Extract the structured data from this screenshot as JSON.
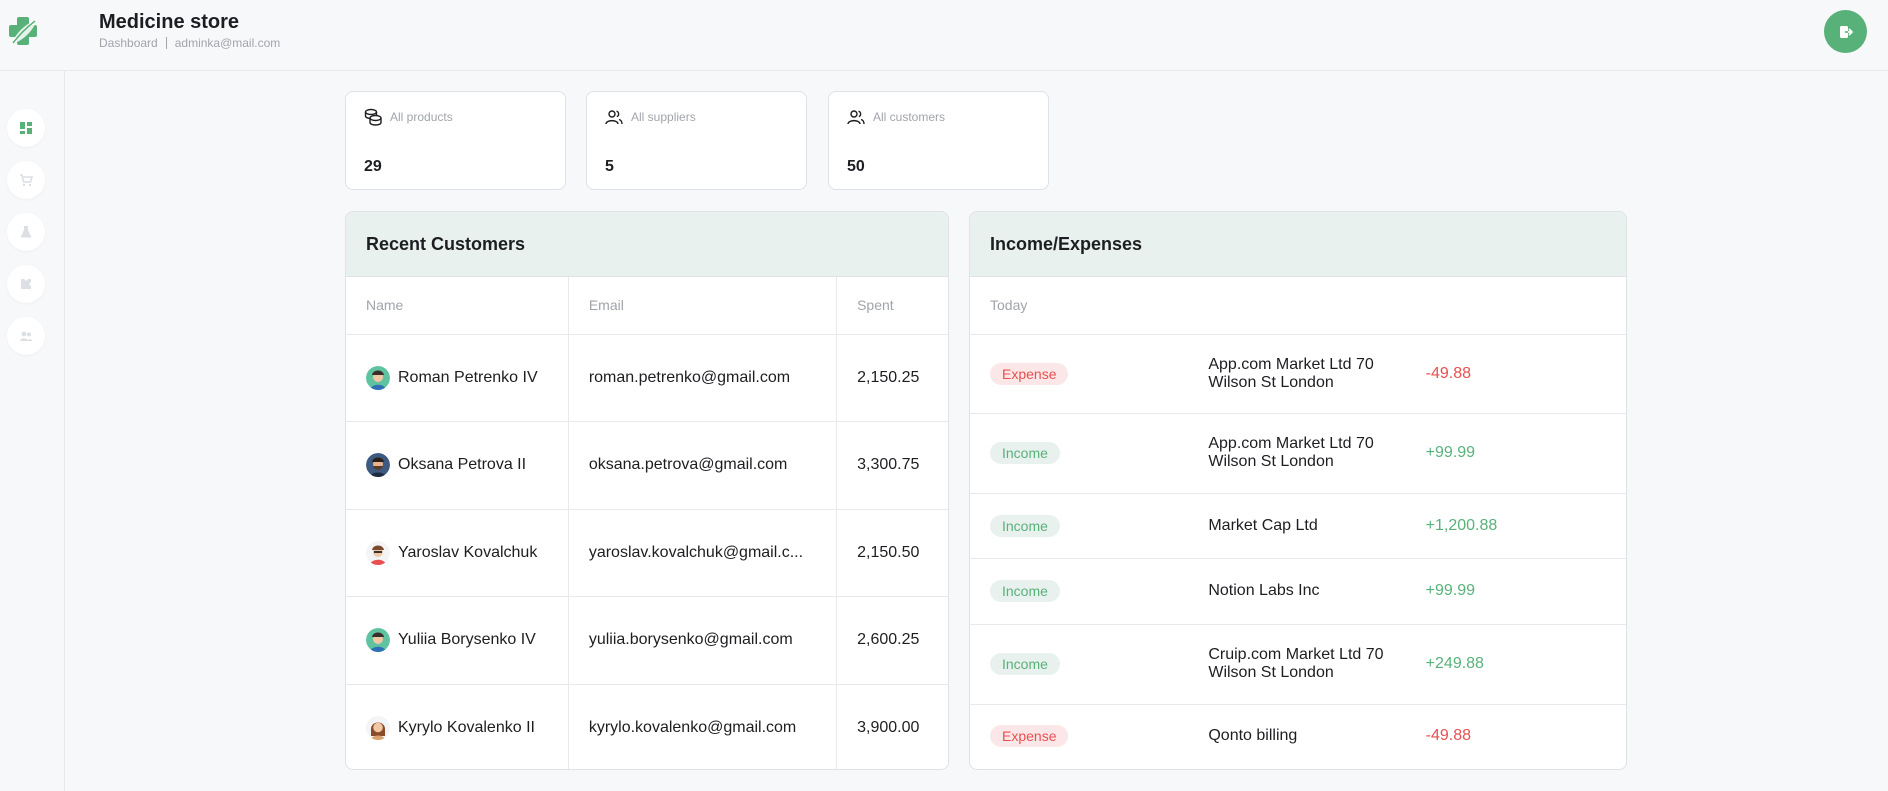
{
  "header": {
    "title": "Medicine store",
    "breadcrumb": "Dashboard",
    "email": "adminka@mail.com",
    "logout_icon": "logout-icon"
  },
  "sidebar": {
    "items": [
      {
        "icon": "dashboard-icon",
        "active": true
      },
      {
        "icon": "cart-icon",
        "active": false
      },
      {
        "icon": "flask-icon",
        "active": false
      },
      {
        "icon": "puzzle-icon",
        "active": false
      },
      {
        "icon": "users-icon",
        "active": false
      }
    ]
  },
  "stats": [
    {
      "label": "All products",
      "value": "29",
      "icon": "coins-icon"
    },
    {
      "label": "All suppliers",
      "value": "5",
      "icon": "users-icon"
    },
    {
      "label": "All customers",
      "value": "50",
      "icon": "users-icon"
    }
  ],
  "recent_customers": {
    "title": "Recent Customers",
    "columns": [
      "Name",
      "Email",
      "Spent"
    ],
    "rows": [
      {
        "name": "Roman Petrenko IV",
        "email": "roman.petrenko@gmail.com",
        "spent": "2,150.25"
      },
      {
        "name": "Oksana Petrova II",
        "email": "oksana.petrova@gmail.com",
        "spent": "3,300.75"
      },
      {
        "name": "Yaroslav Kovalchuk",
        "email": "yaroslav.kovalchuk@gmail.c...",
        "spent": "2,150.50"
      },
      {
        "name": "Yuliia Borysenko IV",
        "email": "yuliia.borysenko@gmail.com",
        "spent": "2,600.25"
      },
      {
        "name": "Kyrylo Kovalenko II",
        "email": "kyrylo.kovalenko@gmail.com",
        "spent": "3,900.00"
      }
    ]
  },
  "income_expenses": {
    "title": "Income/Expenses",
    "column": "Today",
    "rows": [
      {
        "type": "Expense",
        "name": "App.com Market Ltd 70 Wilson St London",
        "amount": "-49.88"
      },
      {
        "type": "Income",
        "name": "App.com Market Ltd 70 Wilson St London",
        "amount": "+99.99"
      },
      {
        "type": "Income",
        "name": "Market Cap Ltd",
        "amount": "+1,200.88"
      },
      {
        "type": "Income",
        "name": "Notion Labs Inc",
        "amount": "+99.99"
      },
      {
        "type": "Income",
        "name": "Cruip.com Market Ltd 70 Wilson St London",
        "amount": "+249.88"
      },
      {
        "type": "Expense",
        "name": "Qonto billing",
        "amount": "-49.88"
      }
    ]
  },
  "colors": {
    "brand": "#59b17a",
    "danger": "#e85050",
    "panel_header": "#e8f1ed"
  }
}
